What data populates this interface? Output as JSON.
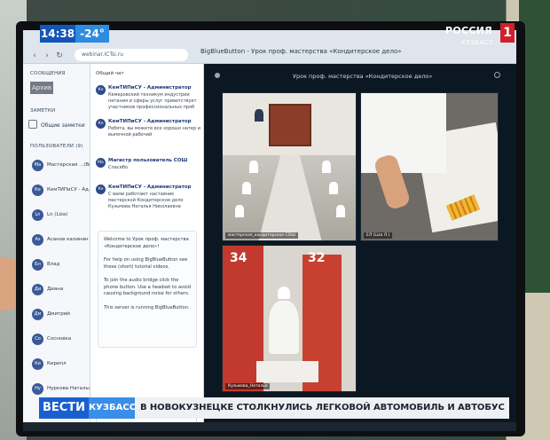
{
  "overlay": {
    "time": "14:38",
    "temperature": "-24°",
    "channel": "РОССИЯ",
    "channel_number": "1",
    "region": "КУЗБАСС",
    "show": "ВЕСТИ",
    "show_region": "КУЗБАСС",
    "headline": "В НОВОКУЗНЕЦКЕ СТОЛКНУЛИСЬ ЛЕГКОВОЙ АВТОМОБИЛЬ И АВТОБУС"
  },
  "browser": {
    "url": "webinar.ICTsi.ru",
    "tab_title": "BigBlueButton - Урок проф. мастерства «Кондитерское дело»"
  },
  "left": {
    "messages_header": "СООБЩЕНИЯ",
    "archive_tag": "Архив",
    "notes_header": "ЗАМЕТКИ",
    "shared_notes": "Общие заметки",
    "users_header": "ПОЛЬЗОВАТЕЛИ (9)",
    "users": [
      {
        "initials": "Ма",
        "name": "Мастерская ...(Вы)"
      },
      {
        "initials": "Ке",
        "name": "КемТИПиСУ - Ад..."
      },
      {
        "initials": "Ln",
        "name": "Ln (Liza)"
      },
      {
        "initials": "Аз",
        "name": "Асанов калинин"
      },
      {
        "initials": "Бл",
        "name": "Влад"
      },
      {
        "initials": "Ди",
        "name": "Диана"
      },
      {
        "initials": "Дм",
        "name": "Дмитрий"
      },
      {
        "initials": "Со",
        "name": "Сосновка"
      },
      {
        "initials": "Ки",
        "name": "Кирилл"
      },
      {
        "initials": "Ну",
        "name": "Нуркова Наталья"
      }
    ]
  },
  "chat": {
    "header": "Общий чат",
    "messages": [
      {
        "initials": "Ке",
        "sender": "КемТИПиСУ - Администратор",
        "text": "Кемеровский техникум индустрии питания и сферы услуг приветствует участников профессиональных проб"
      },
      {
        "initials": "Ке",
        "sender": "КемТИПиСУ - Администратор",
        "text": "Ребята, вы можете все хорошо натер и выпечной рабочий"
      },
      {
        "initials": "Ма",
        "sender": "Магистр пользователь СОШ",
        "text": "Спасибо"
      },
      {
        "initials": "Ке",
        "sender": "КемТИПиСУ - Администратор",
        "text": "С вами работают наставник мастерской Кондитерское дело Кузьмова Наталья Николаевна"
      }
    ],
    "welcome_title": "Welcome to Урок проф. мастерства «Кондитерское дело»!",
    "welcome_help": "For help on using BigBlueButton see these (short) tutorial videos.",
    "welcome_audio": "To join the audio bridge click the phone button. Use a headset to avoid causing background noise for others.",
    "welcome_server": "This server is running BigBlueButton."
  },
  "presentation": {
    "title": "Урок проф. мастерства «Кондитерское дело»",
    "video1_label": "мастерская_кондитерское СОШ",
    "video2_label": "ЕЛ (Liza Л.)",
    "video3_label": "Кузьмова_Наталья",
    "booth_left": "34",
    "booth_right": "32"
  }
}
